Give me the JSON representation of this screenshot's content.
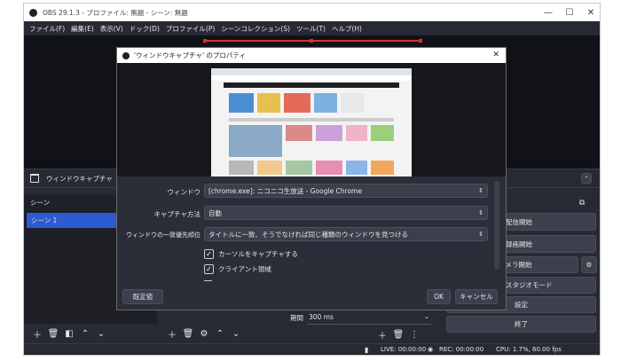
{
  "window": {
    "title": "OBS 29.1.3 - プロファイル: 無題 - シーン: 無題",
    "minimize": "—",
    "maximize": "☐",
    "close": "✕"
  },
  "menu": [
    "ファイル(F)",
    "編集(E)",
    "表示(V)",
    "ドック(D)",
    "プロファイル(P)",
    "シーンコレクション(S)",
    "ツール(T)",
    "ヘルプ(H)"
  ],
  "source_bar": {
    "label": "ウィンドウキャプチャ"
  },
  "scenes": {
    "header": "シーン",
    "items": [
      "シーン 1"
    ]
  },
  "transition": {
    "label": "期間",
    "value": "300 ms"
  },
  "controls": {
    "items": [
      "配信開始",
      "録画開始",
      "カメラ開始",
      "スタジオモード",
      "設定",
      "終了"
    ]
  },
  "status": {
    "live": "LIVE: 00:00:00",
    "rec": "REC: 00:00:00",
    "cpu": "CPU: 1.7%, 60.00 fps"
  },
  "dialog": {
    "title": "'ウィンドウキャプチャ' のプロパティ",
    "close": "✕",
    "fields": [
      {
        "label": "ウィンドウ",
        "value": "[chrome.exe]: ニコニコ生放送 - Google Chrome"
      },
      {
        "label": "キャプチャ方法",
        "value": "自動"
      },
      {
        "label": "ウィンドウの一致優先順位",
        "value": "タイトルに一致、そうでなければ同じ種類のウィンドウを見つける"
      }
    ],
    "checkboxes": [
      {
        "label": "カーソルをキャプチャする",
        "checked": true
      },
      {
        "label": "クライアント領域",
        "checked": true
      }
    ],
    "defaults_button": "既定値",
    "ok_button": "OK",
    "cancel_button": "キャンセル"
  },
  "colors": {
    "accent": "#2d5bd1",
    "live_red": "#d9302c",
    "background": "#272a33"
  }
}
